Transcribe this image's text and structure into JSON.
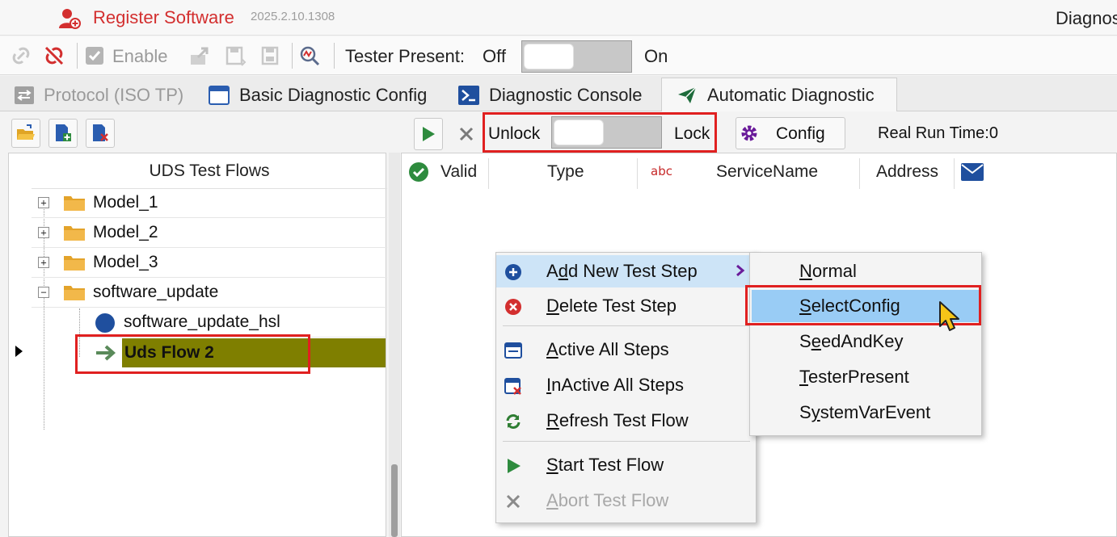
{
  "titlebar": {
    "register_label": "Register Software",
    "version": "2025.2.10.1308",
    "app_title": "Diagnostic"
  },
  "toolbar": {
    "enable_label": "Enable",
    "tester_present_label": "Tester Present:",
    "off_label": "Off",
    "on_label": "On"
  },
  "tabs": [
    {
      "label": "Protocol (ISO TP)",
      "state": "inactive"
    },
    {
      "label": "Basic Diagnostic Config",
      "state": "normal"
    },
    {
      "label": "Diagnostic Console",
      "state": "normal"
    },
    {
      "label": "Automatic Diagnostic",
      "state": "active"
    }
  ],
  "tree": {
    "header": "UDS Test Flows",
    "items": [
      {
        "label": "Model_1",
        "type": "folder",
        "expander": "+"
      },
      {
        "label": "Model_2",
        "type": "folder",
        "expander": "+"
      },
      {
        "label": "Model_3",
        "type": "folder",
        "expander": "+"
      },
      {
        "label": "software_update",
        "type": "folder",
        "expander": "−"
      },
      {
        "label": "software_update_hsl",
        "type": "flow"
      },
      {
        "label": "Uds Flow 2",
        "type": "flow-selected"
      }
    ]
  },
  "flow_toolbar": {
    "unlock_label": "Unlock",
    "lock_label": "Lock",
    "config_label": "Config",
    "real_run_time": "Real Run Time:0"
  },
  "grid": {
    "columns": [
      "Valid",
      "Type",
      "ServiceName",
      "Address"
    ],
    "abc_badge": "abc"
  },
  "context_menu": {
    "items": [
      {
        "pre": "A",
        "u": "d",
        "post": "d New Test Step",
        "icon": "add-circle-icon",
        "hover": true,
        "submenu": true
      },
      {
        "pre": "",
        "u": "D",
        "post": "elete Test Step",
        "icon": "delete-circle-icon"
      },
      {
        "pre": "",
        "u": "A",
        "post": "ctive All Steps",
        "icon": "active-steps-icon"
      },
      {
        "pre": "",
        "u": "I",
        "post": "nActive All Steps",
        "icon": "inactive-steps-icon"
      },
      {
        "pre": "",
        "u": "R",
        "post": "efresh Test Flow",
        "icon": "refresh-icon"
      },
      {
        "pre": "",
        "u": "S",
        "post": "tart Test Flow",
        "icon": "play-icon"
      },
      {
        "pre": "",
        "u": "A",
        "post": "bort Test Flow",
        "icon": "abort-icon",
        "disabled": true
      }
    ]
  },
  "submenu": {
    "items": [
      {
        "pre": "",
        "u": "N",
        "post": "ormal"
      },
      {
        "pre": "",
        "u": "S",
        "post": "electConfig",
        "selected": true
      },
      {
        "pre": "S",
        "u": "e",
        "post": "edAndKey"
      },
      {
        "pre": "",
        "u": "T",
        "post": "esterPresent"
      },
      {
        "pre": "S",
        "u": "y",
        "post": "stemVarEvent"
      }
    ]
  },
  "colors": {
    "accent_red": "#d32f2f",
    "highlight_red": "#e02020",
    "selected_row": "#7f7f00",
    "menu_hover": "#cde4f7",
    "submenu_selected": "#99ccf5",
    "play_green": "#2e8b3e"
  }
}
